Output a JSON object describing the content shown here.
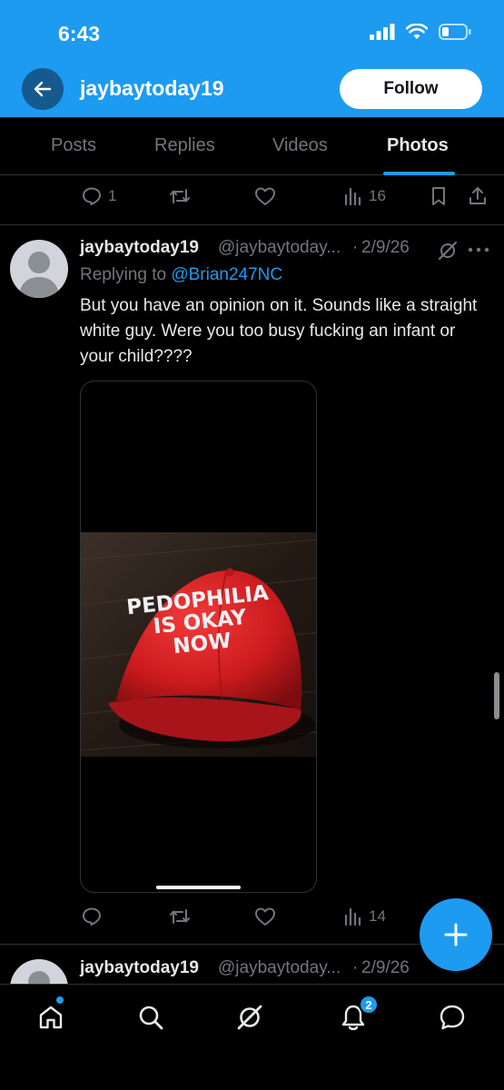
{
  "status_bar": {
    "time": "6:43"
  },
  "header": {
    "title": "jaybaytoday19",
    "follow_label": "Follow"
  },
  "tabs": [
    {
      "label": "Posts"
    },
    {
      "label": "Replies"
    },
    {
      "label": "Videos"
    },
    {
      "label": "Photos",
      "active": true
    }
  ],
  "prev_post_actions": {
    "replies": "1",
    "views": "16"
  },
  "post": {
    "display_name": "jaybaytoday19",
    "handle": "@jaybaytoday...",
    "separator": "·",
    "date": "2/9/26",
    "replying_prefix": "Replying to ",
    "replying_to": "@Brian247NC",
    "text": "But you have an opinion on it. Sounds like a straight white guy. Were you too busy fucking an infant or your child????",
    "media": {
      "cap_text_lines": [
        "PEDOPHILIA",
        "IS OKAY",
        "NOW"
      ]
    },
    "actions": {
      "views": "14"
    }
  },
  "next_post": {
    "display_name": "jaybaytoday19",
    "handle": "@jaybaytoday...",
    "separator": "·",
    "date": "2/9/26"
  },
  "bottom_nav": {
    "notifications_badge": "2"
  },
  "colors": {
    "accent": "#1d9bf0",
    "background": "#000000",
    "muted": "#71767b",
    "text": "#e7e9ea"
  }
}
